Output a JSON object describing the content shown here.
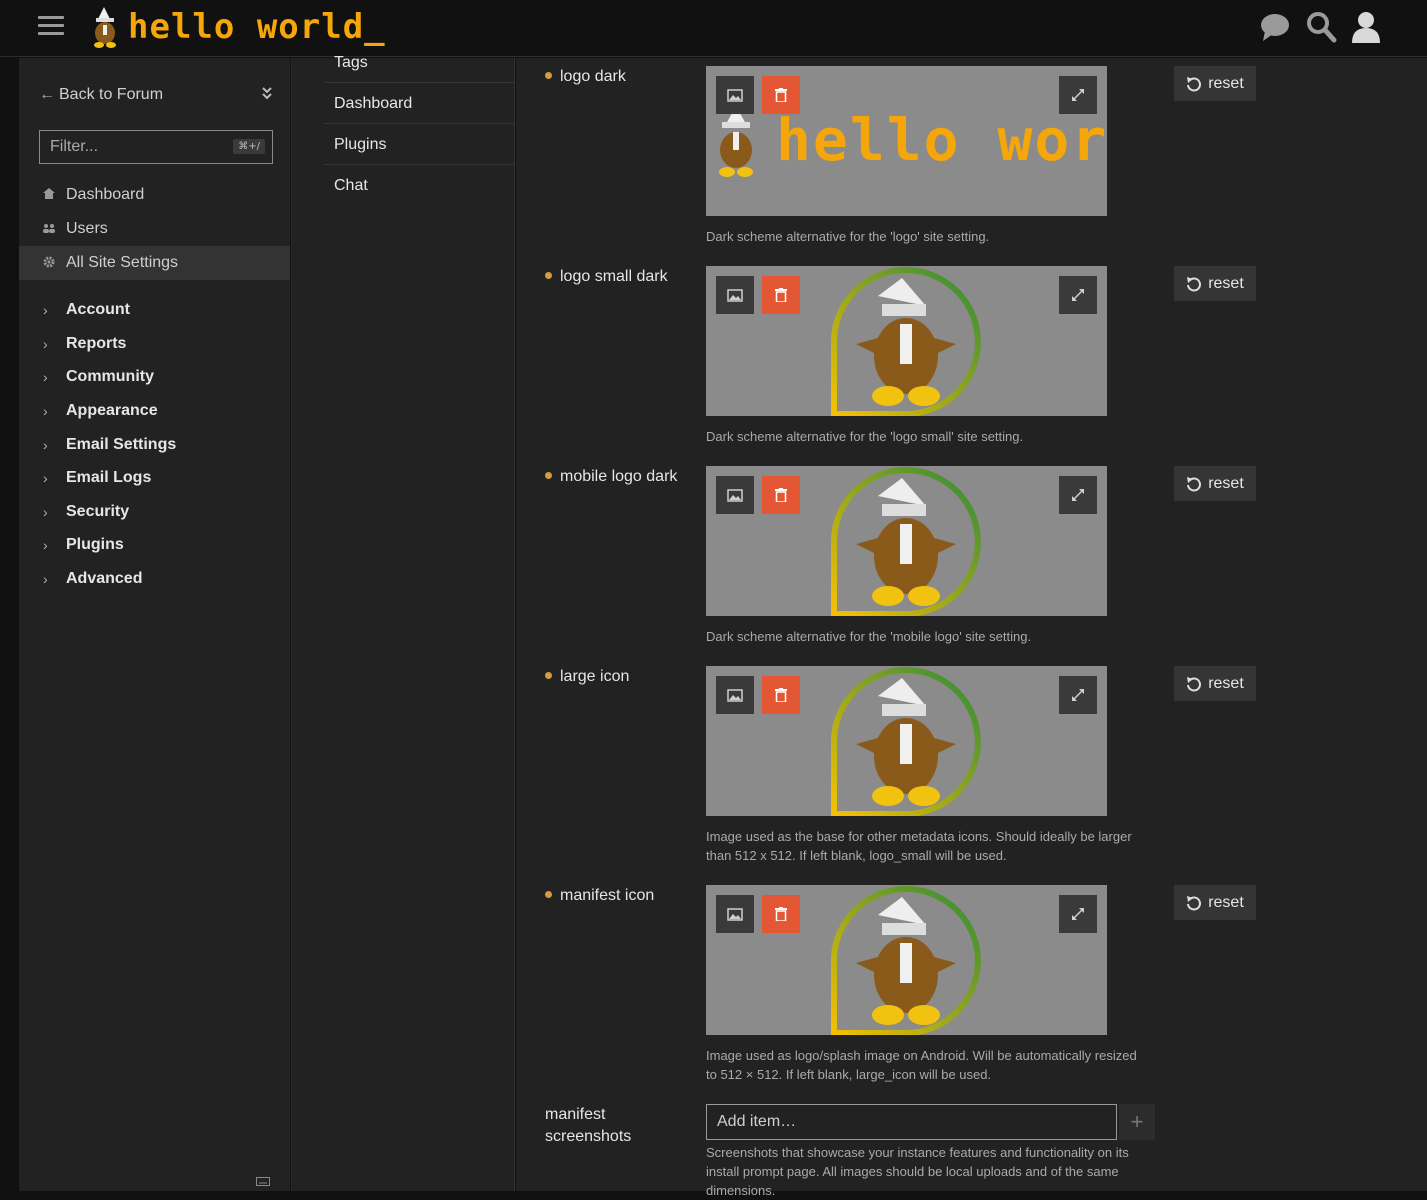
{
  "header": {
    "brand_text": "hello world_",
    "icons": [
      "hamburger-icon",
      "chat-icon",
      "search-icon",
      "user-icon"
    ],
    "accent": "#f5a60a"
  },
  "sidebar": {
    "back_label": "Back to Forum",
    "filter_placeholder": "Filter...",
    "filter_shortcut": "⌘+/",
    "items": [
      {
        "label": "Dashboard",
        "icon": "home-icon"
      },
      {
        "label": "Users",
        "icon": "users-icon"
      },
      {
        "label": "All Site Settings",
        "icon": "gear-icon"
      }
    ],
    "categories": [
      "Account",
      "Reports",
      "Community",
      "Appearance",
      "Email Settings",
      "Email Logs",
      "Security",
      "Plugins",
      "Advanced"
    ]
  },
  "subnav": {
    "items": [
      "Tags",
      "Dashboard",
      "Plugins",
      "Chat"
    ]
  },
  "settings": [
    {
      "label": "logo dark",
      "description": "Dark scheme alternative for the 'logo' site setting.",
      "preview": "wordmark"
    },
    {
      "label": "logo small dark",
      "description": "Dark scheme alternative for the 'logo small' site setting.",
      "preview": "mascot"
    },
    {
      "label": "mobile logo dark",
      "description": "Dark scheme alternative for the 'mobile logo' site setting.",
      "preview": "mascot"
    },
    {
      "label": "large icon",
      "description": "Image used as the base for other metadata icons. Should ideally be larger than 512 x 512. If left blank, logo_small will be used.",
      "preview": "mascot"
    },
    {
      "label": "manifest icon",
      "description": "Image used as logo/splash image on Android. Will be automatically resized to 512 × 512. If left blank, large_icon will be used.",
      "preview": "mascot"
    }
  ],
  "reset_label": "reset",
  "manifest_screenshots": {
    "label": "manifest screenshots",
    "placeholder": "Add item…",
    "description": "Screenshots that showcase your instance features and functionality on its install prompt page. All images should be local uploads and of the same dimensions."
  },
  "colors": {
    "delete_button": "#e45735",
    "modified_dot": "#d89a3a",
    "preview_bg": "#8b8b8b"
  }
}
